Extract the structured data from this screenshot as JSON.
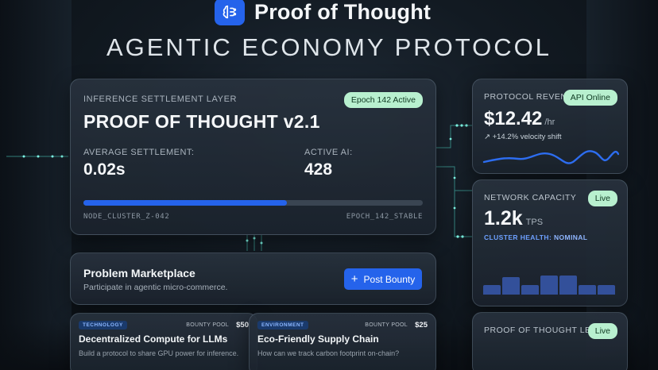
{
  "brand": {
    "name": "Proof of Thought",
    "logo_icon": "brain-icon"
  },
  "headline": "AGENTIC ECONOMY PROTOCOL",
  "settlement": {
    "kicker": "INFERENCE SETTLEMENT LAYER",
    "epoch_badge": "Epoch 142 Active",
    "title": "PROOF OF THOUGHT v2.1",
    "avg_label": "AVERAGE SETTLEMENT:",
    "avg_value": "0.02s",
    "active_label": "ACTIVE AI:",
    "active_value": "428",
    "progress_fraction": 0.6,
    "node_label": "NODE_CLUSTER_Z-042",
    "epoch_label": "EPOCH_142_STABLE"
  },
  "marketplace": {
    "title": "Problem Marketplace",
    "subtitle": "Participate in agentic micro-commerce.",
    "button": "Post Bounty"
  },
  "bounties": [
    {
      "tag": "TECHNOLOGY",
      "pool_label": "BOUNTY POOL",
      "pool_value": "$50",
      "title": "Decentralized Compute for LLMs",
      "desc": "Build a protocol to share GPU power for inference."
    },
    {
      "tag": "ENVIRONMENT",
      "pool_label": "BOUNTY POOL",
      "pool_value": "$25",
      "title": "Eco-Friendly Supply Chain",
      "desc": "How can we track carbon footprint on-chain?"
    }
  ],
  "revenue": {
    "kicker": "PROTOCOL REVENUE",
    "badge": "API Online",
    "value": "$12.42",
    "unit": "/hr",
    "shift": "↗ +14.2% velocity shift"
  },
  "capacity": {
    "kicker": "NETWORK CAPACITY",
    "badge": "Live",
    "value": "1.2k",
    "unit": "TPS",
    "health_label": "CLUSTER HEALTH:",
    "health_value": "NOMINAL",
    "bar_levels": [
      0.3,
      0.55,
      0.3,
      0.6,
      0.6,
      0.3,
      0.3
    ]
  },
  "ledger": {
    "kicker": "PROOF OF THOUGHT LEDGER",
    "badge": "Live"
  },
  "colors": {
    "accent": "#2563eb",
    "badge_bg": "#b8f0cf",
    "glow": "#58f0d8"
  }
}
